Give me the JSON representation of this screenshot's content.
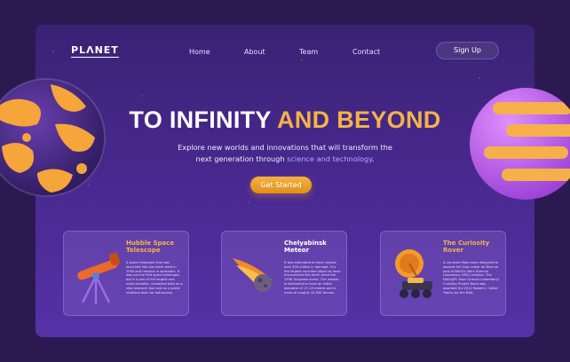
{
  "brand": {
    "logo": "PLΛNET"
  },
  "nav": {
    "items": [
      {
        "label": "Home"
      },
      {
        "label": "About"
      },
      {
        "label": "Team"
      },
      {
        "label": "Contact"
      }
    ],
    "signup": "Sign Up"
  },
  "hero": {
    "title_white": "TO INFINITY ",
    "title_accent": "AND BEYOND",
    "subtitle_line1": "Explore new worlds and innovations that will transform the",
    "subtitle_line2_prefix": "next generation through ",
    "subtitle_link": "science and technology",
    "subtitle_suffix": ".",
    "cta": "Get Started"
  },
  "cards": [
    {
      "title": "Hubble Space Telescope",
      "text": "A space telescope that was launched into low Earth orbit in 1990 and remains in operation. It was not the first space telescope, but it is one of the largest and most versatile, renowned both as a vital research tool and as a public relations boon for astronomy.",
      "icon": "telescope-icon",
      "title_color": "#f3b347"
    },
    {
      "title": "Chelyabinsk Meteor",
      "text": "It was estimated to have caused over $33 million in damage. It is the largest recorded object to have encountered the Earth since the 1908 Tunguska event. The meteor is estimated to have an initial diameter of 17–20 metres and a mass of roughly 10,000 tonnes.",
      "icon": "meteor-icon",
      "title_color": "#ffffff"
    },
    {
      "title": "The Curiosity Rover",
      "text": "A car-sized Mars rover designed to explore the Gale crater on Mars as part of NASA's Mars Science Laboratory (MSL) mission. The NASA/JPL Mars Science Laboratory/ Curiosity Project Team was awarded the 2012 Robert J. Collier Trophy by the NAA.",
      "icon": "rover-icon",
      "title_color": "#f3b347"
    }
  ],
  "colors": {
    "background": "#2b1a52",
    "accent": "#f3b347",
    "panel": "#4a2a92"
  }
}
